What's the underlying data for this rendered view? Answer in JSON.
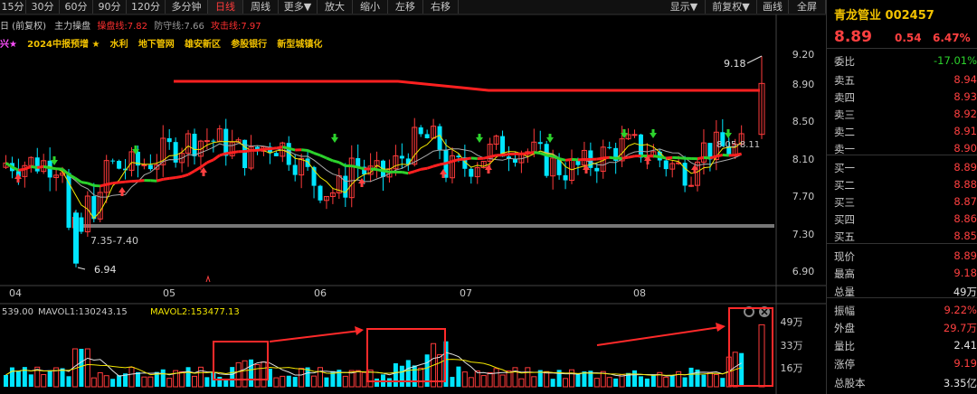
{
  "toolbar": {
    "items": [
      "15分",
      "30分",
      "60分",
      "90分",
      "120分",
      "多分钟",
      "日线",
      "周线",
      "更多▼",
      "放大",
      "缩小",
      "左移",
      "右移",
      "显示▼",
      "前复权▼",
      "画线",
      "全屏"
    ],
    "active": "日线"
  },
  "legend": {
    "prefix": "日 (前复权)",
    "indicator": "主力操盘",
    "l1": "操盘线:7.82",
    "l2": "防守线:7.66",
    "l3": "攻击线:7.97"
  },
  "tags": {
    "first": "兴★",
    "items": [
      "2024中报预增 ★",
      "水利",
      "地下管网",
      "雄安新区",
      "参股银行",
      "新型城镇化"
    ]
  },
  "chart": {
    "y_ticks": [
      "9.20",
      "8.90",
      "8.50",
      "8.10",
      "7.70",
      "7.30",
      "6.90"
    ],
    "x_labels": [
      "04",
      "05",
      "06",
      "07",
      "08"
    ],
    "annotations": {
      "high": "9.18",
      "low": "6.94",
      "range": "7.35-7.40",
      "mid": "8.05-8.11"
    },
    "colors": {
      "up": "#ff3b3b",
      "down": "#00e5ff",
      "ma_up": "#ff2020",
      "ma_flat": "#2cd22c",
      "ma2": "#aaaaaa",
      "ma3": "#f2e600"
    }
  },
  "volume": {
    "legend0": "539.00",
    "legend1": "MAVOL1:130243.15",
    "legend2": "MAVOL2:153477.13",
    "y_ticks": [
      "49万",
      "33万",
      "16万"
    ]
  },
  "side": {
    "title": "青龙管业  002457",
    "price": "8.89",
    "change": "0.54",
    "pct": "6.47%",
    "rows": [
      {
        "k": "委比",
        "v": "-17.01%",
        "c": "#2cd22c"
      },
      {
        "k": "卖五",
        "v": "8.94",
        "c": "#ff4040"
      },
      {
        "k": "卖四",
        "v": "8.93",
        "c": "#ff4040"
      },
      {
        "k": "卖三",
        "v": "8.92",
        "c": "#ff4040"
      },
      {
        "k": "卖二",
        "v": "8.91",
        "c": "#ff4040"
      },
      {
        "k": "卖一",
        "v": "8.90",
        "c": "#ff4040"
      },
      {
        "k": "买一",
        "v": "8.89",
        "c": "#ff4040"
      },
      {
        "k": "买二",
        "v": "8.88",
        "c": "#ff4040"
      },
      {
        "k": "买三",
        "v": "8.87",
        "c": "#ff4040"
      },
      {
        "k": "买四",
        "v": "8.86",
        "c": "#ff4040"
      },
      {
        "k": "买五",
        "v": "8.85",
        "c": "#ff4040"
      },
      {
        "k": "现价",
        "v": "8.89",
        "c": "#ff4040"
      },
      {
        "k": "最高",
        "v": "9.18",
        "c": "#ff4040"
      },
      {
        "k": "总量",
        "v": "49万",
        "c": "#e0e0e0"
      },
      {
        "k": "振幅",
        "v": "9.22%",
        "c": "#ff4040"
      },
      {
        "k": "外盘",
        "v": "29.7万",
        "c": "#ff4040"
      },
      {
        "k": "量比",
        "v": "2.41",
        "c": "#e0e0e0"
      },
      {
        "k": "涨停",
        "v": "9.19",
        "c": "#ff4040"
      },
      {
        "k": "总股本",
        "v": "3.35亿",
        "c": "#e0e0e0"
      }
    ]
  }
}
